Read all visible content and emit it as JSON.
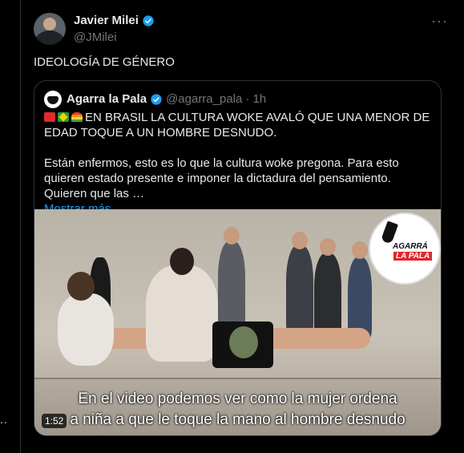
{
  "author": {
    "name": "Javier Milei",
    "handle": "@JMilei"
  },
  "tweet_text": "IDEOLOGÍA DE GÉNERO",
  "quote": {
    "name": "Agarra la Pala",
    "handle": "@agarra_pala",
    "time": "· 1h",
    "headline": "EN BRASIL LA CULTURA WOKE AVALÓ QUE UNA MENOR DE EDAD TOQUE A UN HOMBRE DESNUDO.",
    "body": "Están enfermos, esto es lo que la cultura woke pregona. Para esto quieren estado presente e imponer la dictadura del pensamiento. Quieren que las …",
    "show_more": "Mostrar más"
  },
  "media": {
    "caption_line1": "En el video podemos ver como la mujer ordena",
    "caption_line2": "a niña a que le toque la mano al hombre desnudo",
    "duration": "1:52",
    "logo_line1": "AGARRÁ",
    "logo_line2": "LA PALA"
  },
  "colors": {
    "background": "#000000",
    "text": "#e7e9ea",
    "secondary": "#71767b",
    "accent": "#1d9bf0",
    "border": "#2f3336"
  }
}
